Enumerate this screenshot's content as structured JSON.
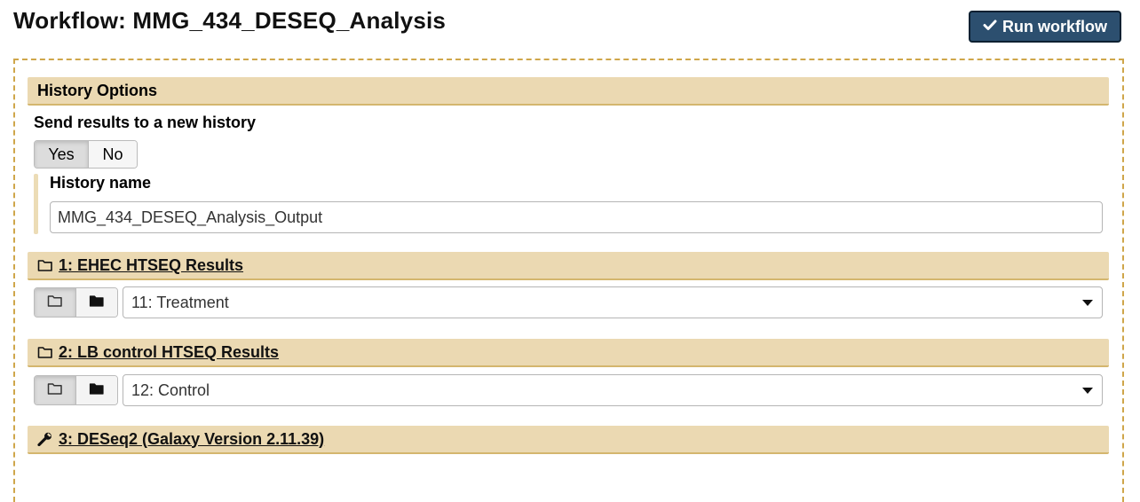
{
  "workflow": {
    "title": "Workflow: MMG_434_DESEQ_Analysis",
    "run_button_label": "Run workflow"
  },
  "history_options": {
    "header": "History Options",
    "send_results_label": "Send results to a new history",
    "toggle": {
      "yes": "Yes",
      "no": "No",
      "selected": "Yes"
    },
    "history_name_label": "History name",
    "history_name_value": "MMG_434_DESEQ_Analysis_Output"
  },
  "steps": [
    {
      "header": "1: EHEC HTSEQ Results",
      "icon": "folder-open-icon",
      "selected_dataset": "11: Treatment"
    },
    {
      "header": "2: LB control HTSEQ Results",
      "icon": "folder-open-icon",
      "selected_dataset": "12: Control"
    },
    {
      "header": "3: DESeq2 (Galaxy Version 2.11.39)",
      "icon": "wrench-icon"
    }
  ],
  "colors": {
    "run_button_bg": "#2c4f6f",
    "section_header_bg": "#ebd9b2",
    "frame_border": "#cfa64a"
  }
}
